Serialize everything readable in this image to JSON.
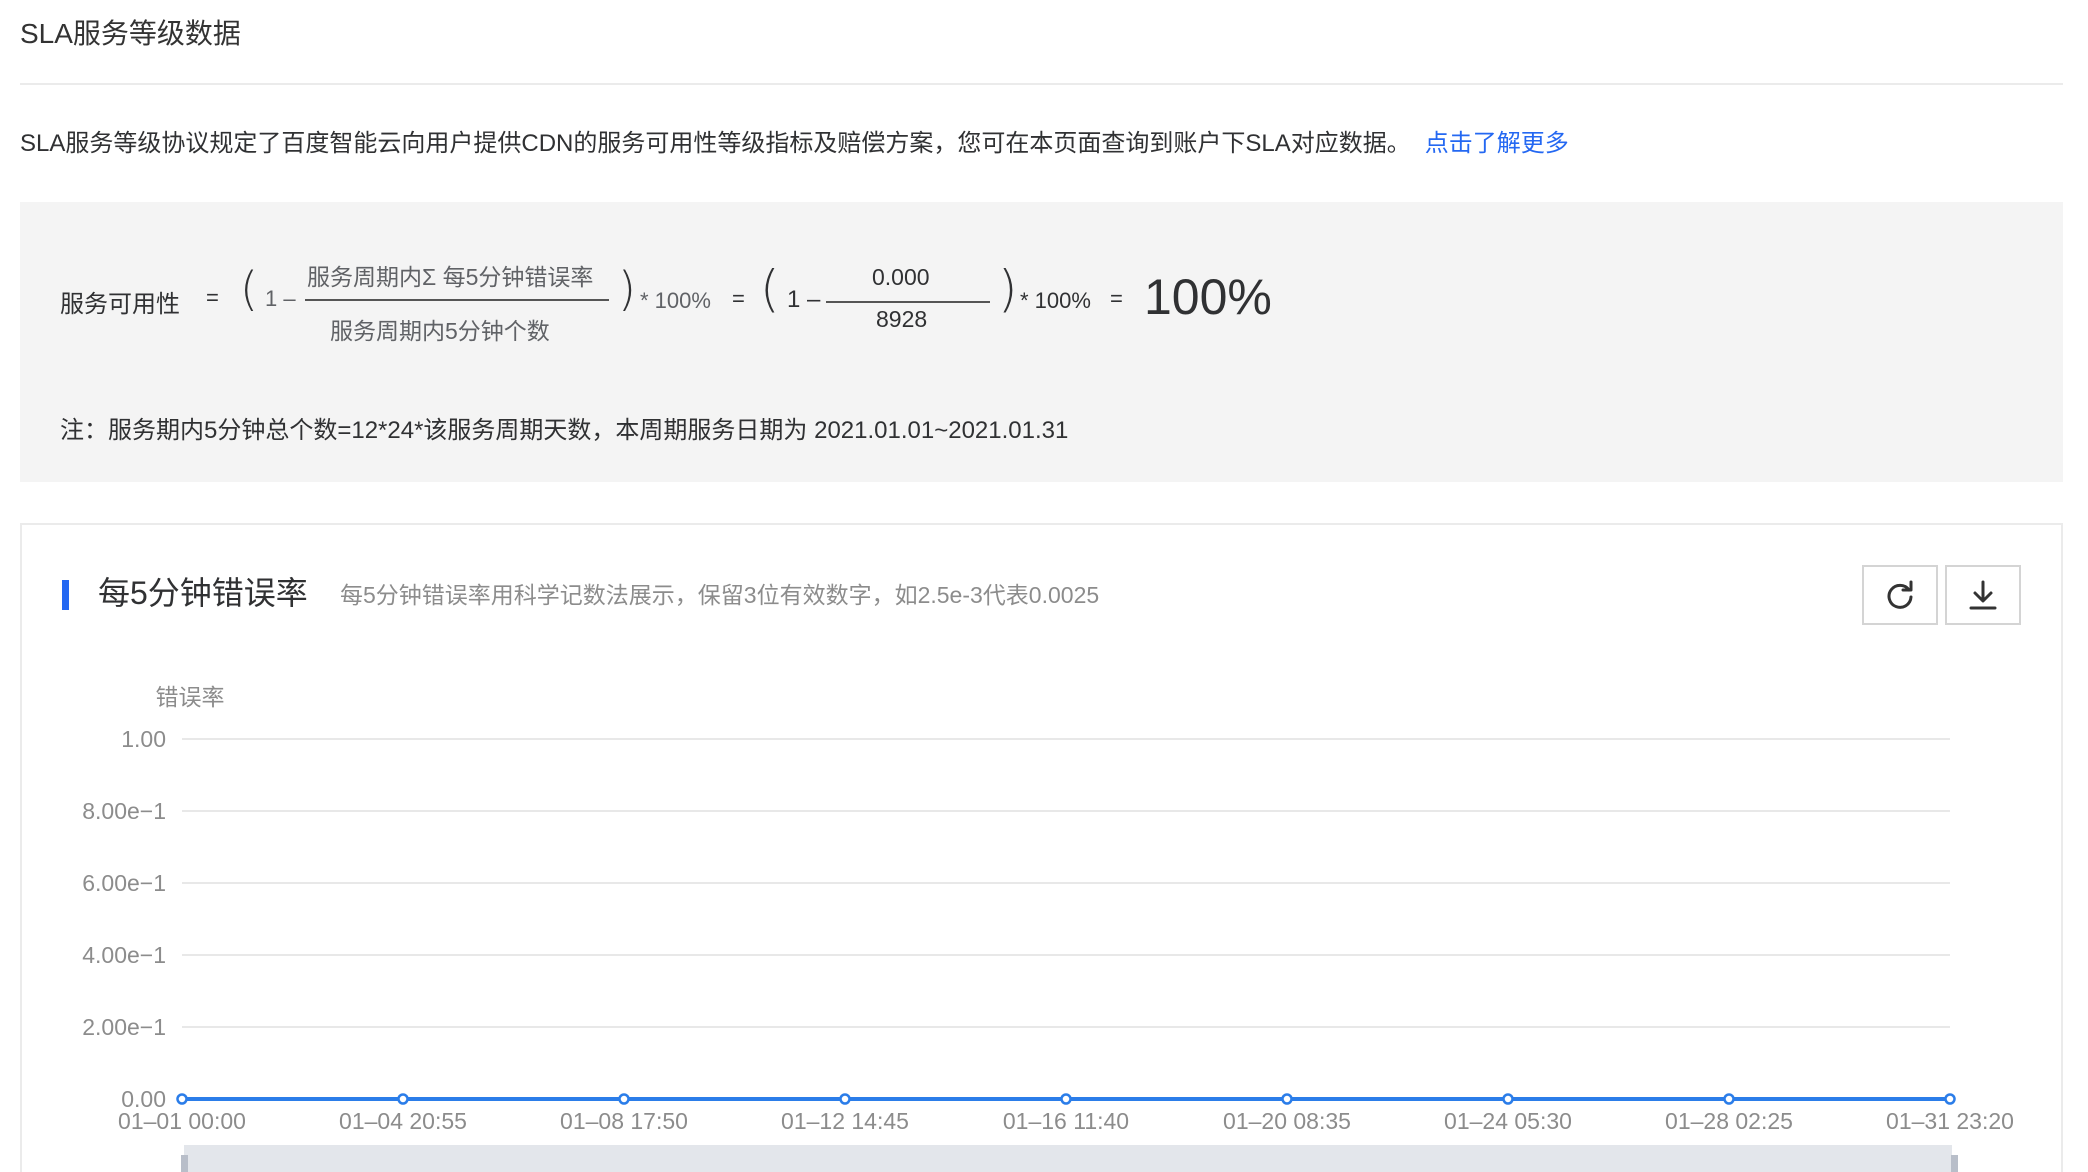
{
  "page": {
    "title": "SLA服务等级数据",
    "intro_text": "SLA服务等级协议规定了百度智能云向用户提供CDN的服务可用性等级指标及赔偿方案，您可在本页面查询到账户下SLA对应数据。",
    "intro_link": "点击了解更多"
  },
  "formula": {
    "label": "服务可用性",
    "equals": "=",
    "one_minus": "1 –",
    "numerator_text": "服务周期内Σ 每5分钟错误率",
    "denominator_text": "服务周期内5分钟个数",
    "times_100": "* 100%",
    "numerator_value": "0.000",
    "denominator_value": "8928",
    "result": "100%",
    "note": "注：服务期内5分钟总个数=12*24*该服务周期天数，本周期服务日期为 2021.01.01~2021.01.31"
  },
  "chart_panel": {
    "title": "每5分钟错误率",
    "description": "每5分钟错误率用科学记数法展示，保留3位有效数字，如2.5e-3代表0.0025",
    "refresh_icon": "refresh-icon",
    "download_icon": "download-icon"
  },
  "chart_data": {
    "type": "line",
    "title": "",
    "ylabel": "错误率",
    "xlabel": "",
    "ylim": [
      0,
      1
    ],
    "yticks": [
      "0.00",
      "2.00e−1",
      "4.00e−1",
      "6.00e−1",
      "8.00e−1",
      "1.00"
    ],
    "ytick_values": [
      0,
      0.2,
      0.4,
      0.6,
      0.8,
      1.0
    ],
    "categories": [
      "01–01 00:00",
      "01–04 20:55",
      "01–08 17:50",
      "01–12 14:45",
      "01–16 11:40",
      "01–20 08:35",
      "01–24 05:30",
      "01–28 02:25",
      "01–31 23:20"
    ],
    "series": [
      {
        "values": [
          0,
          0,
          0,
          0,
          0,
          0,
          0,
          0,
          0
        ]
      }
    ],
    "grid": true,
    "line_color": "#2b7de9"
  }
}
